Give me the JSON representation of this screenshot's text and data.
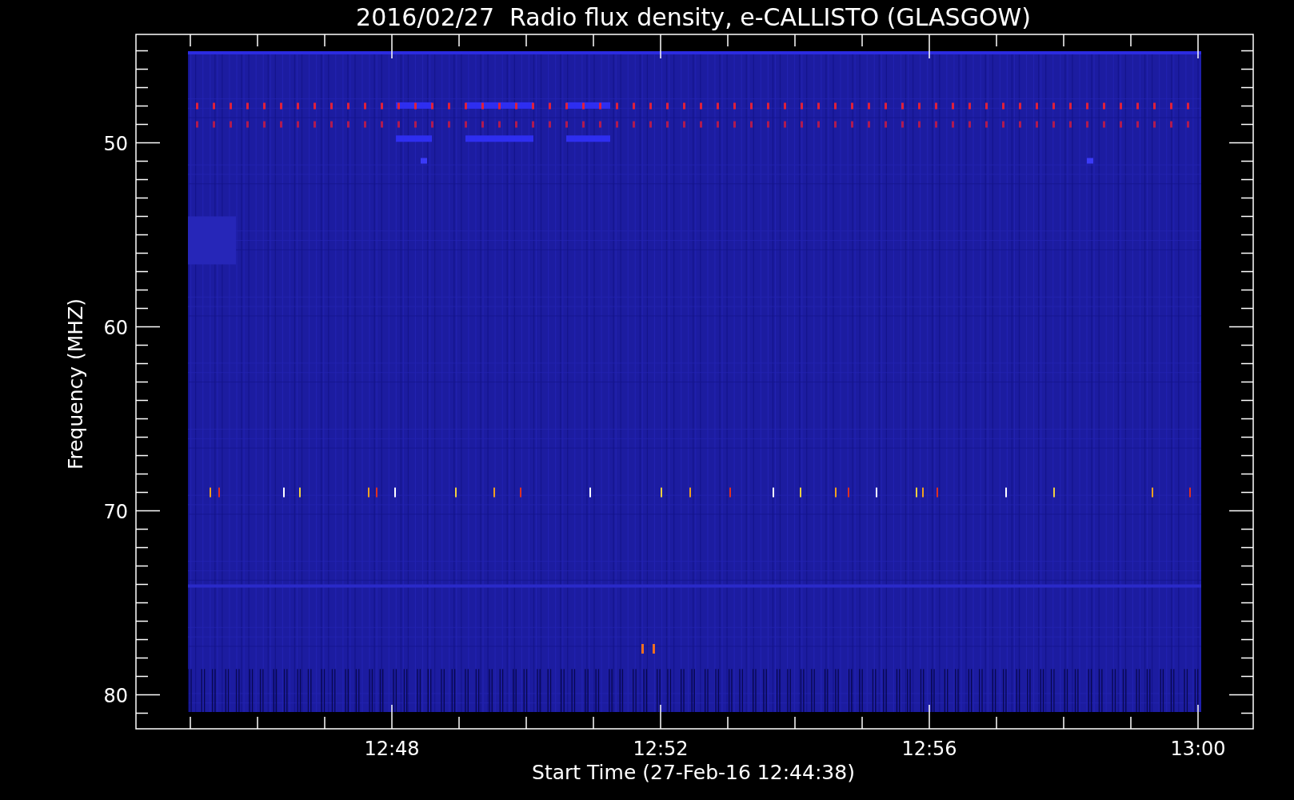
{
  "title": "2016/02/27  Radio flux density, e-CALLISTO (GLASGOW)",
  "y_axis": {
    "label": "Frequency (MHZ)",
    "tick_labels": [
      "50",
      "60",
      "70",
      "80"
    ]
  },
  "x_axis": {
    "label": "Start Time (27-Feb-16 12:44:38)",
    "tick_labels": [
      "12:48",
      "12:52",
      "12:56",
      "13:00"
    ]
  }
}
